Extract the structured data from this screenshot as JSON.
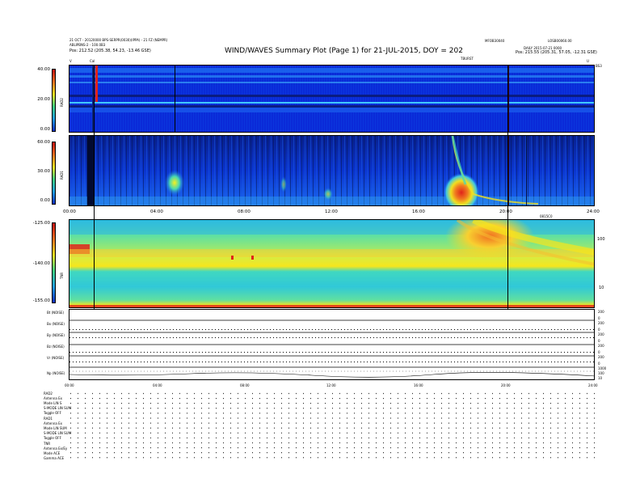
{
  "header": {
    "left_line1": "21 OCT - 20120000 BPS-SERPR(0030)(IPPA) - 21 FZ (NEMPR)",
    "left_line2": "ABLIPBNS-2 - 100.0B3",
    "left_line3": "Pos:   212.52 (205.38, 54.23, -13.46 GSE)",
    "title": "WIND/WAVES Summary Plot (Page 1) for 21-JUL-2015, DOY = 202",
    "right_mid": "MFOB30040",
    "right_top": "LOSB00060.00",
    "right_line2": "DAILY  2015-07-21 0000",
    "right_line3": "Pos:   215.55 (205.31, 57.05, -12.31 GSE)",
    "right_mid2": "TBURST",
    "corner_v_left": "V",
    "corner_v_right": "U",
    "corner_c": "Cal",
    "corner_far": "BS3"
  },
  "panels": {
    "rad2": {
      "label": "RAD2",
      "ticks": [
        "40.00",
        "20.00",
        "0.00"
      ]
    },
    "rad1": {
      "label": "RAD1",
      "ticks": [
        "60.00",
        "30.00",
        "0.00"
      ]
    },
    "tnr": {
      "label": "TNR",
      "ticks": [
        "-125.00",
        "-140.00",
        "-155.00"
      ],
      "right_ticks": [
        "100",
        "10"
      ]
    }
  },
  "time_axis": {
    "labels": [
      "00:00",
      "04:00",
      "08:00",
      "12:00",
      "16:00",
      "20:00",
      "24:00"
    ],
    "extra_label": "0815C0"
  },
  "aux_rows": [
    {
      "label": "Bt (NOISE)",
      "ticks": [
        "200",
        "0"
      ]
    },
    {
      "label": "Bx (NOISE)",
      "ticks": [
        "200",
        "0"
      ]
    },
    {
      "label": "By (NOISE)",
      "ticks": [
        "200",
        "0"
      ]
    },
    {
      "label": "Bz (NOISE)",
      "ticks": [
        "200",
        "0"
      ]
    },
    {
      "label": "Vr (NOISE)",
      "ticks": [
        "200",
        "0"
      ]
    },
    {
      "label": "Np (NOISE)",
      "ticks": [
        "1000",
        "100",
        "10"
      ]
    }
  ],
  "bottom_labels": [
    "RAD2",
    "Antenna    Ex",
    "Mode     LIN S",
    "S-MODE     LIN SUM",
    "Toggle     OFF",
    "RAD1",
    "Antenna    Ex",
    "Mode  LIN SUM",
    "S-MODE     LIN SUM",
    "Toggle     OFF",
    "TNR",
    "Antenna  Ex/Ey",
    "Mode       ACE",
    "Gamma      ACE"
  ],
  "colors": {
    "background": "#ffffff",
    "bg_blue": "#0a2ad8",
    "tnr_base": "#35d6c2",
    "tnr_band": "#f1e318",
    "burst_red": "#e0241a"
  },
  "chart_data": [
    {
      "type": "heatmap",
      "title": "RAD2",
      "y_ticks": [
        40,
        20,
        0
      ],
      "x_range": [
        0,
        24
      ]
    },
    {
      "type": "heatmap",
      "title": "RAD1",
      "y_ticks": [
        60,
        30,
        0
      ],
      "x_range": [
        0,
        24
      ],
      "features": [
        {
          "x": 4.9,
          "kind": "type III burst"
        },
        {
          "x": 17.8,
          "kind": "type III / II burst"
        }
      ]
    },
    {
      "type": "heatmap",
      "title": "TNR",
      "y_ticks": [
        -125,
        -140,
        -155
      ],
      "x_range": [
        0,
        24
      ]
    }
  ]
}
